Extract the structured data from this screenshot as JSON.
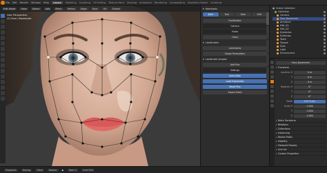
{
  "top_menu": {
    "menus": [
      "File",
      "Edit",
      "Render",
      "Window",
      "Help"
    ],
    "workspaces": [
      "Layout",
      "Modeling",
      "Sculpting",
      "UV Editing",
      "Texture Paint",
      "Shading",
      "Animation",
      "Rendering",
      "Compositing",
      "Geometry Nodes",
      "Scripting"
    ],
    "active_workspace": "Layout",
    "scene_name": "Scene",
    "view_layer": "ViewLayer"
  },
  "viewport_header": {
    "mode": "Edit Mode",
    "buttons": [
      "View",
      "Select",
      "Add",
      "Mesh",
      "Vertex",
      "Edge",
      "Face",
      "UV"
    ],
    "transform": "Global"
  },
  "overlay": {
    "line1": "User Perspective",
    "line2": "(1) Face | Basemesh"
  },
  "npanel": {
    "title": "Keentools",
    "tabs": [
      "Item",
      "Tool",
      "View",
      "Edit"
    ],
    "rows": [
      "FaceBuilder",
      "Camera",
      "Views",
      "Head",
      "Landmarks",
      "Shape Parameters",
      "Add Pins",
      "Auto-Align",
      "Load Expression",
      "Reset Pins",
      "Export Head"
    ],
    "section1": "Landmarks",
    "section2": "Landmark shapes",
    "settings": "Settings"
  },
  "outliner": {
    "title": "Scene Collection",
    "items": [
      {
        "name": "Collection",
        "indent": 0,
        "type": "collection"
      },
      {
        "name": "Camera",
        "indent": 1,
        "type": "object"
      },
      {
        "name": "Face_Basemesh",
        "indent": 1,
        "type": "object"
      },
      {
        "name": "Armature",
        "indent": 1,
        "type": "object"
      },
      {
        "name": "Hair_01",
        "indent": 2,
        "type": "mesh"
      },
      {
        "name": "Hair_02",
        "indent": 2,
        "type": "mesh"
      },
      {
        "name": "Eyelashes",
        "indent": 2,
        "type": "mesh"
      },
      {
        "name": "Eyebrows",
        "indent": 2,
        "type": "mesh"
      },
      {
        "name": "Teeth",
        "indent": 2,
        "type": "mesh"
      },
      {
        "name": "Tongue",
        "indent": 2,
        "type": "mesh"
      },
      {
        "name": "Eyes",
        "indent": 2,
        "type": "mesh"
      },
      {
        "name": "Light",
        "indent": 1,
        "type": "object"
      },
      {
        "name": "Environment",
        "indent": 1,
        "type": "object"
      }
    ]
  },
  "properties": {
    "object_name": "Face_Basemesh",
    "sections": [
      {
        "title": "Transform"
      },
      {
        "title": "Delta Transform"
      },
      {
        "title": "Relations"
      },
      {
        "title": "Collections"
      },
      {
        "title": "Instancing"
      },
      {
        "title": "Motion Paths"
      },
      {
        "title": "Visibility"
      },
      {
        "title": "Viewport Display"
      },
      {
        "title": "Line Art"
      },
      {
        "title": "Custom Properties"
      }
    ],
    "fields": [
      {
        "label": "Location X",
        "value": "0 m"
      },
      {
        "label": "Y",
        "value": "0 m"
      },
      {
        "label": "Z",
        "value": "0 m"
      },
      {
        "label": "Rotation X",
        "value": "0°"
      },
      {
        "label": "Y",
        "value": "0°"
      },
      {
        "label": "Z",
        "value": "0°"
      },
      {
        "label": "Mode",
        "value": "XYZ Euler"
      },
      {
        "label": "Scale X",
        "value": "1.000"
      },
      {
        "label": "Y",
        "value": "1.000"
      },
      {
        "label": "Z",
        "value": "1.000"
      }
    ]
  },
  "timeline": {
    "items": [
      "Playback",
      "Keying",
      "View",
      "Marker"
    ],
    "start": "Start 1",
    "end": "End 250"
  },
  "colors": {
    "accent": "#4772b3",
    "orange": "#e87d0d",
    "bg": "#1d1d1d",
    "panel": "#2d2d2d"
  }
}
